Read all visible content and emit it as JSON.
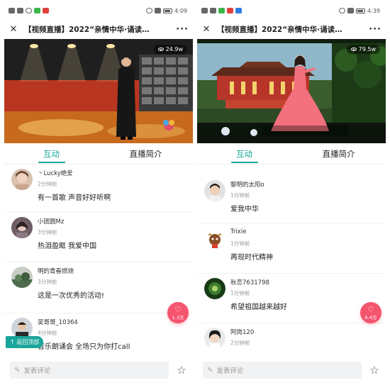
{
  "screens": [
    {
      "status": {
        "icons_left": "signal wifi nfc app-icons",
        "time": "4:09"
      },
      "title": "【视频直播】2022“亲情中华·诵读…",
      "video": {
        "views": "24.9w"
      },
      "tabs": [
        "互动",
        "直播简介"
      ],
      "comments": [
        {
          "name": "丶Lucky绝爱",
          "time": "2分钟前",
          "text": "有一首歌 声音好好听啊"
        },
        {
          "name": "小团圆Mz",
          "time": "3分钟前",
          "text": "热泪盈眶 我爱中国"
        },
        {
          "name": "明的青春燃烧",
          "time": "3分钟前",
          "text": "这是一次优秀的活动!"
        },
        {
          "name": "吴哥哥_10364",
          "time": "4分钟前",
          "text": "音乐朗诵会 全场只为你打call"
        }
      ],
      "like_count": "1.3万",
      "back_to_top": "返回顶部",
      "input_placeholder": "发表评论"
    },
    {
      "status": {
        "icons_left": "signal wifi app-icons",
        "time": "4:39"
      },
      "title": "【视频直播】2022“亲情中华·诵读…",
      "video": {
        "views": "79.5w"
      },
      "tabs": [
        "互动",
        "直播简介"
      ],
      "comments": [
        {
          "name": "黎明的太阳o",
          "time": "1分钟前",
          "text": "爱我中华"
        },
        {
          "name": "Trixie",
          "time": "1分钟前",
          "text": "再现时代精神"
        },
        {
          "name": "秋恋7631798",
          "time": "1分钟前",
          "text": "希望祖国越来越好"
        },
        {
          "name": "阿岗120",
          "time": "2分钟前",
          "text": ""
        }
      ],
      "like_count": "6.4万",
      "input_placeholder": "发表评论"
    }
  ],
  "colors": {
    "accent": "#13a598",
    "like": "#f4546e",
    "back_top": "#19a69b"
  }
}
